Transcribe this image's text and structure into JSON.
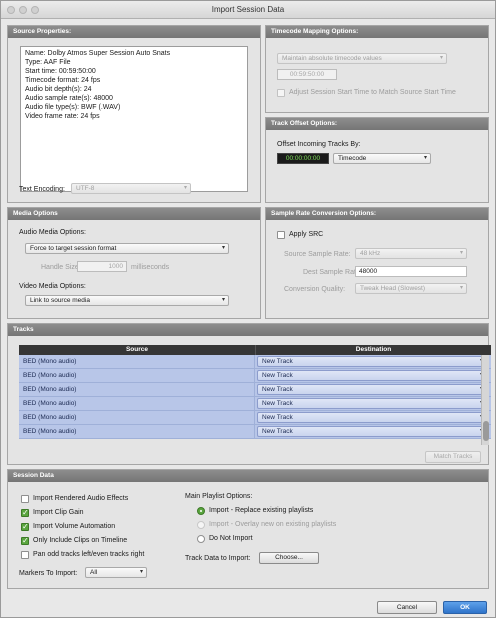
{
  "window": {
    "title": "Import Session Data"
  },
  "source_properties": {
    "header": "Source Properties:",
    "lines": [
      "Name: Dolby Atmos Super Session Auto Snats",
      "Type: AAF File",
      "Start time: 00:59:50:00",
      "Timecode format: 24 fps",
      "Audio bit depth(s): 24",
      "Audio sample rate(s): 48000",
      "Audio file type(s): BWF (.WAV)",
      "Video frame rate: 24 fps"
    ],
    "text_encoding_label": "Text Encoding:",
    "text_encoding_value": "UTF-8"
  },
  "timecode_mapping": {
    "header": "Timecode Mapping Options:",
    "mode": "Maintain absolute timecode values",
    "timecode": "00:59:50:00",
    "adjust_label": "Adjust Session Start Time to Match Source Start Time"
  },
  "track_offset": {
    "header": "Track Offset Options:",
    "label": "Offset Incoming Tracks By:",
    "value": "00:00:00:00",
    "unit": "Timecode"
  },
  "media_options": {
    "header": "Media Options",
    "audio_label": "Audio Media Options:",
    "audio_value": "Force to target session format",
    "handle_label": "Handle Size:",
    "handle_value": "1000",
    "handle_unit": "milliseconds",
    "video_label": "Video Media Options:",
    "video_value": "Link to source media"
  },
  "src": {
    "header": "Sample Rate Conversion Options:",
    "apply_label": "Apply SRC",
    "source_rate_label": "Source Sample Rate:",
    "source_rate_value": "48 kHz",
    "dest_rate_label": "Dest Sample Rate:",
    "dest_rate_value": "48000",
    "quality_label": "Conversion Quality:",
    "quality_value": "Tweak Head (Slowest)"
  },
  "tracks": {
    "header": "Tracks",
    "col_source": "Source",
    "col_destination": "Destination",
    "rows": [
      {
        "source": "BED (Mono audio)",
        "destination": "New Track"
      },
      {
        "source": "BED (Mono audio)",
        "destination": "New Track"
      },
      {
        "source": "BED (Mono audio)",
        "destination": "New Track"
      },
      {
        "source": "BED (Mono audio)",
        "destination": "New Track"
      },
      {
        "source": "BED (Mono audio)",
        "destination": "New Track"
      },
      {
        "source": "BED (Mono audio)",
        "destination": "New Track"
      }
    ],
    "match_button": "Match Tracks"
  },
  "session_data": {
    "header": "Session Data",
    "options": [
      {
        "label": "Import Rendered Audio Effects",
        "checked": false
      },
      {
        "label": "Import Clip Gain",
        "checked": true
      },
      {
        "label": "Import Volume Automation",
        "checked": true
      },
      {
        "label": "Only Include Clips on Timeline",
        "checked": true
      },
      {
        "label": "Pan odd tracks left/even tracks right",
        "checked": false
      }
    ],
    "markers_label": "Markers To Import:",
    "markers_value": "All",
    "playlist_label": "Main Playlist Options:",
    "playlist_options": [
      {
        "label": "Import - Replace existing playlists",
        "selected": true
      },
      {
        "label": "Import - Overlay new on existing playlists",
        "selected": false
      },
      {
        "label": "Do Not Import",
        "selected": false
      }
    ],
    "track_data_label": "Track Data to Import:",
    "choose_button": "Choose..."
  },
  "footer": {
    "cancel": "Cancel",
    "ok": "OK"
  }
}
